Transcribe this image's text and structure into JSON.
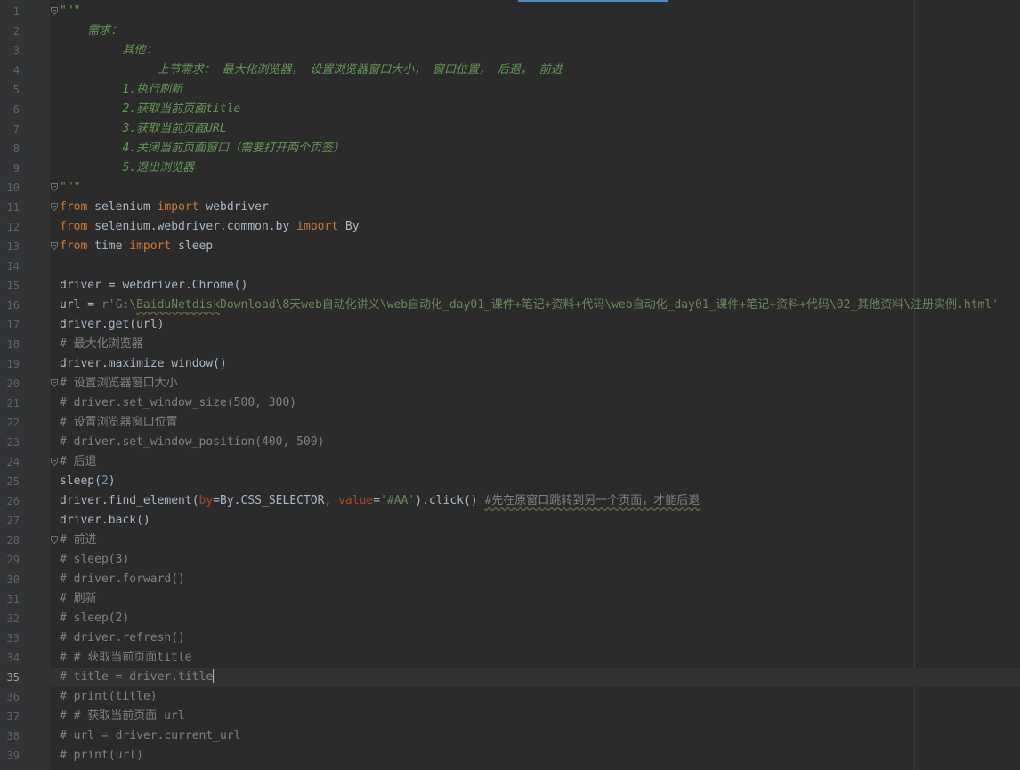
{
  "editor": {
    "current_line": 35,
    "colors": {
      "background": "#2b2b2b",
      "gutter": "#313335",
      "keyword": "#cc7832",
      "string": "#6a8759",
      "comment": "#808080",
      "docstring": "#629755",
      "number": "#6897bb",
      "param": "#aa4926",
      "text": "#a9b7c6"
    },
    "lines": [
      {
        "n": "1",
        "fold": true,
        "tokens": [
          {
            "t": "\"\"\"",
            "c": "doc"
          }
        ]
      },
      {
        "n": "2",
        "tokens": [
          {
            "t": "    需求：",
            "c": "doc"
          }
        ]
      },
      {
        "n": "3",
        "tokens": [
          {
            "t": "         其他：",
            "c": "doc"
          }
        ]
      },
      {
        "n": "4",
        "tokens": [
          {
            "t": "              上节需求： 最大化浏览器， 设置浏览器窗口大小， 窗口位置， 后退， 前进",
            "c": "doc"
          }
        ]
      },
      {
        "n": "5",
        "tokens": [
          {
            "t": "         1.执行刷新",
            "c": "doc"
          }
        ]
      },
      {
        "n": "6",
        "tokens": [
          {
            "t": "         2.获取当前页面title",
            "c": "doc"
          }
        ]
      },
      {
        "n": "7",
        "tokens": [
          {
            "t": "         3.获取当前页面URL",
            "c": "doc"
          }
        ]
      },
      {
        "n": "8",
        "tokens": [
          {
            "t": "         4.关闭当前页面窗口（需要打开两个页签）",
            "c": "doc"
          }
        ]
      },
      {
        "n": "9",
        "tokens": [
          {
            "t": "         5.退出浏览器",
            "c": "doc"
          }
        ]
      },
      {
        "n": "10",
        "fold": true,
        "tokens": [
          {
            "t": "\"\"\"",
            "c": "doc"
          }
        ]
      },
      {
        "n": "11",
        "fold": true,
        "tokens": [
          {
            "t": "from",
            "c": "kw"
          },
          {
            "t": " selenium "
          },
          {
            "t": "import",
            "c": "kw"
          },
          {
            "t": " webdriver"
          }
        ]
      },
      {
        "n": "12",
        "tokens": [
          {
            "t": "from",
            "c": "kw"
          },
          {
            "t": " selenium.webdriver.common.by "
          },
          {
            "t": "import",
            "c": "kw"
          },
          {
            "t": " By"
          }
        ]
      },
      {
        "n": "13",
        "fold": true,
        "tokens": [
          {
            "t": "from",
            "c": "kw"
          },
          {
            "t": " time "
          },
          {
            "t": "import",
            "c": "kw"
          },
          {
            "t": " sleep"
          }
        ]
      },
      {
        "n": "14",
        "tokens": []
      },
      {
        "n": "15",
        "tokens": [
          {
            "t": "driver = webdriver.Chrome()"
          }
        ]
      },
      {
        "n": "16",
        "tokens": [
          {
            "t": "url = "
          },
          {
            "t": "r'G:\\",
            "c": "str"
          },
          {
            "t": "BaiduNetdisk",
            "c": "str warn"
          },
          {
            "t": "Download\\8天web自动化讲义\\web自动化_day01_课件+笔记+资料+代码\\web自动化_day01_课件+笔记+资料+代码\\02_其他资料\\注册实例.html'",
            "c": "str"
          }
        ]
      },
      {
        "n": "17",
        "tokens": [
          {
            "t": "driver.get(url)"
          }
        ]
      },
      {
        "n": "18",
        "tokens": [
          {
            "t": "# 最大化浏览器",
            "c": "cmt"
          }
        ]
      },
      {
        "n": "19",
        "tokens": [
          {
            "t": "driver.maximize_window()"
          }
        ]
      },
      {
        "n": "20",
        "fold": true,
        "tokens": [
          {
            "t": "# 设置浏览器窗口大小",
            "c": "cmt"
          }
        ]
      },
      {
        "n": "21",
        "tokens": [
          {
            "t": "# driver.set_window_size(500, 300)",
            "c": "cmt"
          }
        ]
      },
      {
        "n": "22",
        "tokens": [
          {
            "t": "# 设置浏览器窗口位置",
            "c": "cmt"
          }
        ]
      },
      {
        "n": "23",
        "tokens": [
          {
            "t": "# driver.set_window_position(400, 500)",
            "c": "cmt"
          }
        ]
      },
      {
        "n": "24",
        "fold": true,
        "tokens": [
          {
            "t": "# 后退",
            "c": "cmt"
          }
        ]
      },
      {
        "n": "25",
        "tokens": [
          {
            "t": "sleep("
          },
          {
            "t": "2",
            "c": "num"
          },
          {
            "t": ")"
          }
        ]
      },
      {
        "n": "26",
        "tokens": [
          {
            "t": "driver.find_element("
          },
          {
            "t": "by",
            "c": "param"
          },
          {
            "t": "=By.CSS_SELECTOR"
          },
          {
            "t": ", ",
            "c": "kw"
          },
          {
            "t": "value",
            "c": "param"
          },
          {
            "t": "="
          },
          {
            "t": "'#AA'",
            "c": "str"
          },
          {
            "t": ").click() "
          },
          {
            "t": "#先在原窗口跳转到另一个页面，才能后退",
            "c": "cmt warn"
          }
        ]
      },
      {
        "n": "27",
        "tokens": [
          {
            "t": "driver.back()"
          }
        ]
      },
      {
        "n": "28",
        "fold": true,
        "tokens": [
          {
            "t": "# 前进",
            "c": "cmt"
          }
        ]
      },
      {
        "n": "29",
        "tokens": [
          {
            "t": "# sleep(3)",
            "c": "cmt"
          }
        ]
      },
      {
        "n": "30",
        "tokens": [
          {
            "t": "# driver.forward()",
            "c": "cmt"
          }
        ]
      },
      {
        "n": "31",
        "tokens": [
          {
            "t": "# 刷新",
            "c": "cmt"
          }
        ]
      },
      {
        "n": "32",
        "tokens": [
          {
            "t": "# sleep(2)",
            "c": "cmt"
          }
        ]
      },
      {
        "n": "33",
        "tokens": [
          {
            "t": "# driver.refresh()",
            "c": "cmt"
          }
        ]
      },
      {
        "n": "34",
        "tokens": [
          {
            "t": "# # 获取当前页面title",
            "c": "cmt"
          }
        ]
      },
      {
        "n": "35",
        "caret": true,
        "tokens": [
          {
            "t": "# title = driver.title",
            "c": "cmt"
          }
        ]
      },
      {
        "n": "36",
        "tokens": [
          {
            "t": "# print(title)",
            "c": "cmt"
          }
        ]
      },
      {
        "n": "37",
        "tokens": [
          {
            "t": "# # 获取当前页面 url",
            "c": "cmt"
          }
        ]
      },
      {
        "n": "38",
        "tokens": [
          {
            "t": "# url = driver.current_url",
            "c": "cmt"
          }
        ]
      },
      {
        "n": "39",
        "tokens": [
          {
            "t": "# print(url)",
            "c": "cmt"
          }
        ]
      }
    ]
  }
}
